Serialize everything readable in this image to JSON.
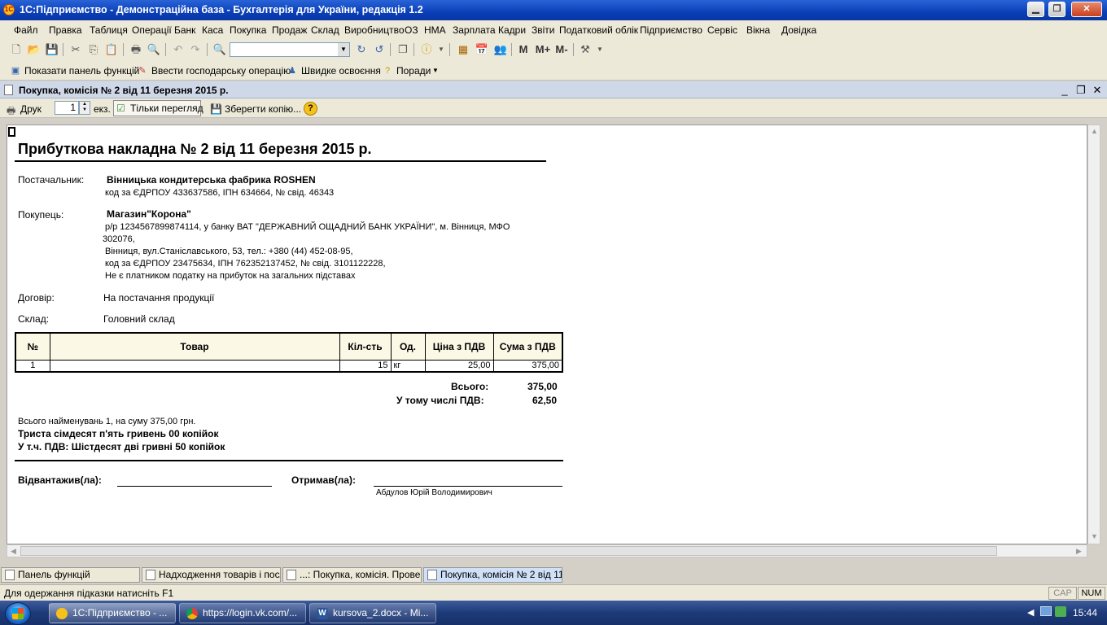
{
  "window": {
    "title": "1С:Підприємство - Демонстраційна база - Бухгалтерія для України, редакція 1.2",
    "logo": "1С"
  },
  "menu": [
    "Файл",
    "Правка",
    "Таблиця",
    "Операції",
    "Банк",
    "Каса",
    "Покупка",
    "Продаж",
    "Склад",
    "Виробництво",
    "ОЗ",
    "НМА",
    "Зарплата",
    "Кадри",
    "Звіти",
    "Податковий облік",
    "Підприємство",
    "Сервіс",
    "Вікна",
    "Довідка"
  ],
  "toolbar": {
    "memory_buttons": [
      "M",
      "M+",
      "M-"
    ]
  },
  "funcbar": {
    "show_panel": "Показати панель функцій",
    "enter_operation": "Ввести господарську операцію",
    "quick_learning": "Швидке освоєння",
    "tips": "Поради"
  },
  "doc_window": {
    "title": "Покупка, комісія № 2 від 11 березня 2015 р."
  },
  "printbar": {
    "print": "Друк",
    "copies": "1",
    "copies_unit": "екз.",
    "view_only": "Тільки перегляд",
    "save_copy": "Зберегти копію...",
    "help": "?"
  },
  "invoice": {
    "title": "Прибуткова накладна № 2 від 11 березня 2015 р.",
    "supplier_label": "Постачальник:",
    "supplier_name": "Вінницька кондитерська фабрика ROSHEN",
    "supplier_details": "код за ЄДРПОУ 433637586,  ІПН 634664,  № свід. 46343",
    "buyer_label": "Покупець:",
    "buyer_name": "Магазин\"Корона\"",
    "buyer_line1": "р/р 1234567899874114,  у банку ВАТ \"ДЕРЖАВНИЙ ОЩАДНИЙ БАНК УКРАЇНИ\", м. Вінниця,  МФО",
    "buyer_line2": "302076,",
    "buyer_line3": "Вінниця, вул.Станіславського, 53,  тел.: +380 (44) 452-08-95,",
    "buyer_line4": "код за ЄДРПОУ 23475634,  ІПН 762352137452,  № свід. 3101122228,",
    "buyer_line5": "Не є платником податку на прибуток на загальних підставах",
    "contract_label": "Договір:",
    "contract_value": "На постачання продукції",
    "warehouse_label": "Склад:",
    "warehouse_value": "Головний склад",
    "table_headers": [
      "№",
      "Товар",
      "Кіл-сть",
      "Од.",
      "Ціна з ПДВ",
      "Сума з ПДВ"
    ],
    "rows": [
      {
        "no": "1",
        "item": "",
        "qty": "15",
        "unit": "кг",
        "price": "25,00",
        "sum": "375,00"
      }
    ],
    "total_label": "Всього:",
    "total_value": "375,00",
    "vat_label": "У тому числі ПДВ:",
    "vat_value": "62,50",
    "items_summary": "Всього найменувань 1, на суму 375,00 грн.",
    "sum_words": "Триста сімдесят п'ять гривень 00 копійок",
    "vat_words": "У т.ч. ПДВ: Шістдесят дві гривні 50 копійок",
    "shipped_label": "Відвантажив(ла):",
    "received_label": "Отримав(ла):",
    "received_name": "Абдулов  Юрій Володимирович"
  },
  "window_tabs": [
    {
      "label": "Панель функцій",
      "active": false
    },
    {
      "label": "Надходження товарів і посл...",
      "active": false
    },
    {
      "label": "...: Покупка, комісія. Прове...",
      "active": false
    },
    {
      "label": "Покупка, комісія № 2 від 11...",
      "active": true
    }
  ],
  "statusbar": {
    "hint": "Для одержання підказки натисніть F1",
    "cap": "CAP",
    "num": "NUM"
  },
  "taskbar": {
    "items": [
      {
        "label": "1С:Підприємство - ...",
        "icon": "1c-icon",
        "color": "#f6c21a"
      },
      {
        "label": "https://login.vk.com/...",
        "icon": "chrome-icon",
        "color": "#4caf50"
      },
      {
        "label": "kursova_2.docx - Mi...",
        "icon": "word-icon",
        "color": "#2b579a"
      }
    ],
    "clock": "15:44"
  }
}
